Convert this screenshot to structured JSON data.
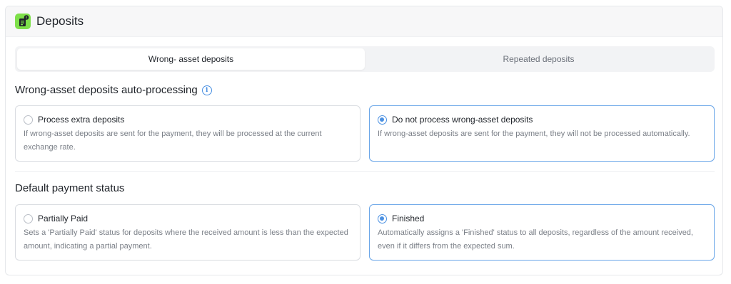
{
  "header": {
    "title": "Deposits",
    "icon": "document-alert-icon",
    "icon_color": "#7ee04a"
  },
  "tabs": [
    {
      "label": "Wrong- asset deposits",
      "active": true
    },
    {
      "label": "Repeated deposits",
      "active": false
    }
  ],
  "sections": [
    {
      "title": "Wrong-asset deposits auto-processing",
      "has_info": true,
      "options": [
        {
          "label": "Process extra deposits",
          "description": "If wrong-asset deposits are sent for the payment, they will be processed at the current exchange rate.",
          "selected": false
        },
        {
          "label": "Do not process wrong-asset deposits",
          "description": "If wrong-asset deposits are sent for the payment, they will not be processed automatically.",
          "selected": true
        }
      ]
    },
    {
      "title": "Default payment status",
      "has_info": false,
      "options": [
        {
          "label": "Partially Paid",
          "description": "Sets a 'Partially Paid' status for deposits where the received amount is less than the expected amount, indicating a partial payment.",
          "selected": false
        },
        {
          "label": "Finished",
          "description": "Automatically assigns a 'Finished' status to all deposits, regardless of the amount received, even if it differs from the expected sum.",
          "selected": true
        }
      ]
    }
  ],
  "colors": {
    "accent": "#4a90e2",
    "selected_border": "#6aa6e8"
  }
}
